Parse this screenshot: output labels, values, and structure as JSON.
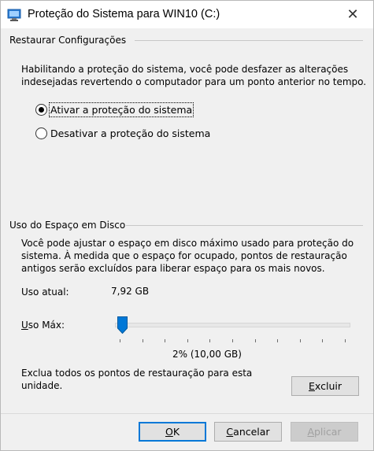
{
  "window": {
    "title": "Proteção do Sistema para WIN10 (C:)"
  },
  "restore_group": {
    "label": "Restaurar Configurações",
    "description_line1": "Habilitando a proteção do sistema, você pode desfazer as alterações",
    "description_line2": "indesejadas revertendo o computador para um ponto anterior no tempo.",
    "option_on": "Ativar a proteção do sistema",
    "option_off": "Desativar a proteção do sistema",
    "selected": "on"
  },
  "disk_group": {
    "label": "Uso do Espaço em Disco",
    "description_line1": "Você pode ajustar o espaço em disco máximo usado para proteção do",
    "description_line2": "sistema. À medida que o espaço for ocupado, pontos de restauração",
    "description_line3": "antigos serão excluídos para liberar espaço para os mais novos.",
    "current_label": "Uso atual:",
    "current_value": "7,92 GB",
    "max_label_prefix": "U",
    "max_label_rest": "so Máx:",
    "max_percent": 2,
    "max_readout": "2% (10,00 GB)",
    "delete_line1": "Exclua todos os pontos de restauração para esta",
    "delete_line2": "unidade.",
    "delete_btn_prefix": "E",
    "delete_btn_rest": "xcluir"
  },
  "footer": {
    "ok_prefix": "O",
    "ok_rest": "K",
    "cancel_prefix": "C",
    "cancel_rest": "ancelar",
    "apply_prefix": "A",
    "apply_rest": "plicar"
  },
  "colors": {
    "accent": "#0078d7",
    "background": "#f0f0f0"
  },
  "icons": {
    "title": "system-protection-icon",
    "close": "close-icon",
    "slider": "slider-thumb"
  }
}
